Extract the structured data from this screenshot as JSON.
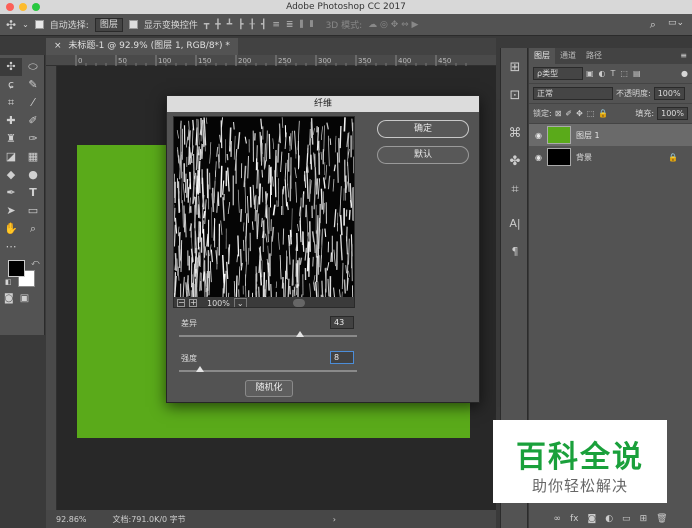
{
  "window": {
    "title": "Adobe Photoshop CC 2017"
  },
  "options_bar": {
    "auto_select_label": "自动选择:",
    "auto_select_value": "图层",
    "show_transform_label": "显示变换控件",
    "mode_3d_label": "3D 模式:"
  },
  "document": {
    "tab_label": "未标题-1 @ 92.9% (图层 1, RGB/8*) *",
    "ruler_ticks": [
      "0",
      "50",
      "100",
      "150",
      "200",
      "250",
      "300",
      "350",
      "400",
      "450"
    ],
    "zoom": "92.86%",
    "doc_info": "文档:791.0K/0 字节"
  },
  "fibers_dialog": {
    "title": "纤维",
    "ok_label": "确定",
    "default_label": "默认",
    "zoom_value": "100%",
    "variance_label": "差异",
    "variance_value": "43",
    "variance_fraction": 0.68,
    "strength_label": "强度",
    "strength_value": "8",
    "strength_fraction": 0.12,
    "randomize_label": "随机化"
  },
  "layers_panel": {
    "tabs": [
      "图层",
      "通道",
      "路径"
    ],
    "filter_label": "ρ类型",
    "blend_mode": "正常",
    "opacity_label": "不透明度:",
    "opacity_value": "100%",
    "lock_label": "锁定:",
    "fill_label": "填充:",
    "fill_value": "100%",
    "layers": [
      {
        "name": "图层 1",
        "color": "#5aaa1a"
      },
      {
        "name": "背景",
        "color": "#000000"
      }
    ]
  },
  "watermark": {
    "title": "百科全说",
    "subtitle": "助你轻松解决"
  },
  "colors": {
    "accent": "#5aaa1a",
    "wm_green": "#1aa03b"
  }
}
